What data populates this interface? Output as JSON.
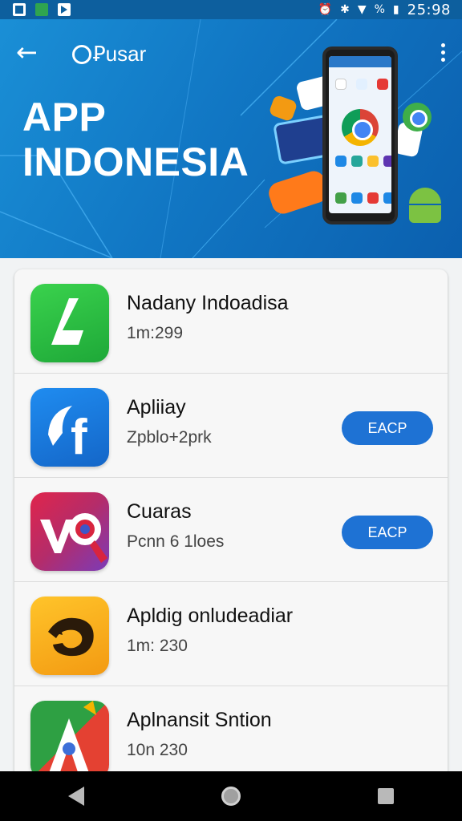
{
  "status_bar": {
    "battery_percent": "%",
    "time": "25:98"
  },
  "header": {
    "back_icon": "arrow-left-icon",
    "brand": "Ꝑusar",
    "more_icon": "more-vert-icon",
    "title_line1": "APP",
    "title_line2": "INDONESIA"
  },
  "apps": [
    {
      "name": "Nadany Indoadisa",
      "subtitle": "1m:299",
      "icon": "green-l-icon",
      "action": ""
    },
    {
      "name": "Apliiay",
      "subtitle": "Zpblo+2prk",
      "icon": "blue-f-icon",
      "action": "EACP"
    },
    {
      "name": "Cuaras",
      "subtitle": "Pcnn 6 1loes",
      "icon": "vc-icon",
      "action": "EACP"
    },
    {
      "name": "Apldig onludeadiar",
      "subtitle": "1m: 230",
      "icon": "orange-swirl-icon",
      "action": ""
    },
    {
      "name": "Aplnansit Sntion",
      "subtitle": "10n 230",
      "icon": "maps-a-icon",
      "action": ""
    }
  ],
  "colors": {
    "header_blue": "#1177c4",
    "accent_button": "#1e72d4",
    "status_bar": "#0d5f9e"
  }
}
